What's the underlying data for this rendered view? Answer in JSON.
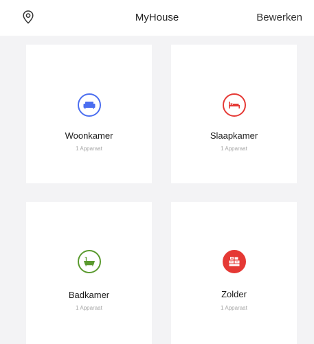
{
  "header": {
    "title": "MyHouse",
    "edit_label": "Bewerken",
    "location_icon": "location-pin-icon"
  },
  "colors": {
    "background": "#f3f3f5",
    "card": "#ffffff",
    "living_accent": "#4b6ef0",
    "bedroom_accent": "#e53935",
    "bathroom_accent": "#5a9a2e",
    "attic_accent": "#e53935"
  },
  "rooms": [
    {
      "name": "Woonkamer",
      "devices": "1 Apparaat",
      "icon": "sofa-icon"
    },
    {
      "name": "Slaapkamer",
      "devices": "1 Apparaat",
      "icon": "bed-icon"
    },
    {
      "name": "Badkamer",
      "devices": "1 Apparaat",
      "icon": "bathtub-icon"
    },
    {
      "name": "Zolder",
      "devices": "1 Apparaat",
      "icon": "storage-boxes-icon"
    }
  ]
}
